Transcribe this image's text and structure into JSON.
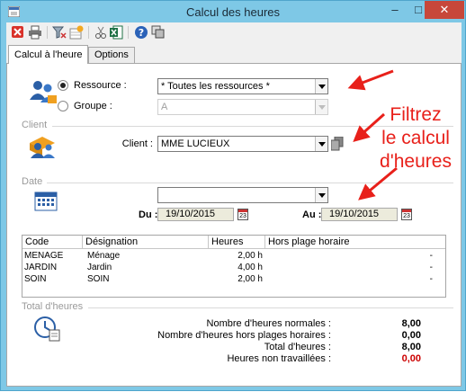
{
  "window": {
    "title": "Calcul des heures",
    "minimize_glyph": "–",
    "maximize_glyph": "□",
    "close_glyph": "✕"
  },
  "toolbar": {
    "icons": [
      "close-red-icon",
      "print-icon",
      "filter-clear-icon",
      "chart-table-icon",
      "scissors-icon",
      "excel-icon",
      "help-icon",
      "copy-icon"
    ]
  },
  "tabs": [
    {
      "label": "Calcul à l'heure",
      "active": true
    },
    {
      "label": "Options",
      "active": false
    }
  ],
  "resource": {
    "ressource_label": "Ressource :",
    "groupe_label": "Groupe :",
    "ressource_value": "* Toutes les ressources *",
    "groupe_value": "A",
    "selected": "ressource"
  },
  "client": {
    "section_title": "Client",
    "label": "Client :",
    "value": "MME LUCIEUX"
  },
  "date": {
    "section_title": "Date",
    "period_value": "",
    "du_label": "Du :",
    "du_value": "19/10/2015",
    "au_label": "Au :",
    "au_value": "19/10/2015",
    "calendar_day": "23"
  },
  "table": {
    "columns": [
      "Code",
      "Désignation",
      "Heures",
      "Hors plage horaire"
    ],
    "rows": [
      {
        "code": "MENAGE",
        "designation": "Ménage",
        "heures": "2,00 h",
        "hors": "-"
      },
      {
        "code": "JARDIN",
        "designation": "Jardin",
        "heures": "4,00 h",
        "hors": "-"
      },
      {
        "code": "SOIN",
        "designation": "SOIN",
        "heures": "2,00 h",
        "hors": "-"
      }
    ]
  },
  "totals": {
    "section_title": "Total d'heures",
    "items": [
      {
        "label": "Nombre d'heures normales :",
        "value": "8,00"
      },
      {
        "label": "Nombre d'heures hors plages horaires :",
        "value": "0,00"
      },
      {
        "label": "Total d'heures :",
        "value": "8,00"
      },
      {
        "label": "Heures non travaillées :",
        "value": "0,00"
      }
    ],
    "negative_color": "#cc0000"
  },
  "annotation": {
    "lines": [
      "Filtrez",
      "le calcul",
      "d'heures"
    ],
    "color": "#e8201a"
  }
}
